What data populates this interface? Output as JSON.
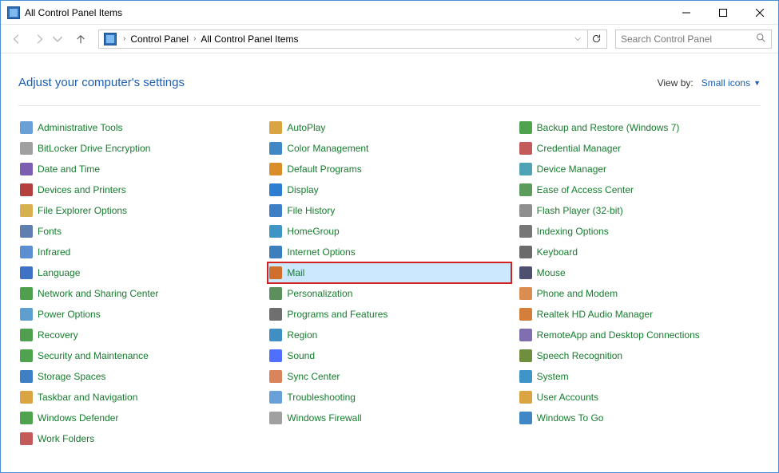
{
  "window": {
    "title": "All Control Panel Items"
  },
  "breadcrumbs": {
    "root": "Control Panel",
    "current": "All Control Panel Items"
  },
  "search": {
    "placeholder": "Search Control Panel"
  },
  "header": {
    "heading": "Adjust your computer's settings",
    "viewby_label": "View by:",
    "viewby_value": "Small icons"
  },
  "items": [
    "Administrative Tools",
    "AutoPlay",
    "Backup and Restore (Windows 7)",
    "BitLocker Drive Encryption",
    "Color Management",
    "Credential Manager",
    "Date and Time",
    "Default Programs",
    "Device Manager",
    "Devices and Printers",
    "Display",
    "Ease of Access Center",
    "File Explorer Options",
    "File History",
    "Flash Player (32-bit)",
    "Fonts",
    "HomeGroup",
    "Indexing Options",
    "Infrared",
    "Internet Options",
    "Keyboard",
    "Language",
    "Mail",
    "Mouse",
    "Network and Sharing Center",
    "Personalization",
    "Phone and Modem",
    "Power Options",
    "Programs and Features",
    "Realtek HD Audio Manager",
    "Recovery",
    "Region",
    "RemoteApp and Desktop Connections",
    "Security and Maintenance",
    "Sound",
    "Speech Recognition",
    "Storage Spaces",
    "Sync Center",
    "System",
    "Taskbar and Navigation",
    "Troubleshooting",
    "User Accounts",
    "Windows Defender",
    "Windows Firewall",
    "Windows To Go",
    "Work Folders"
  ],
  "highlighted_index": 22
}
